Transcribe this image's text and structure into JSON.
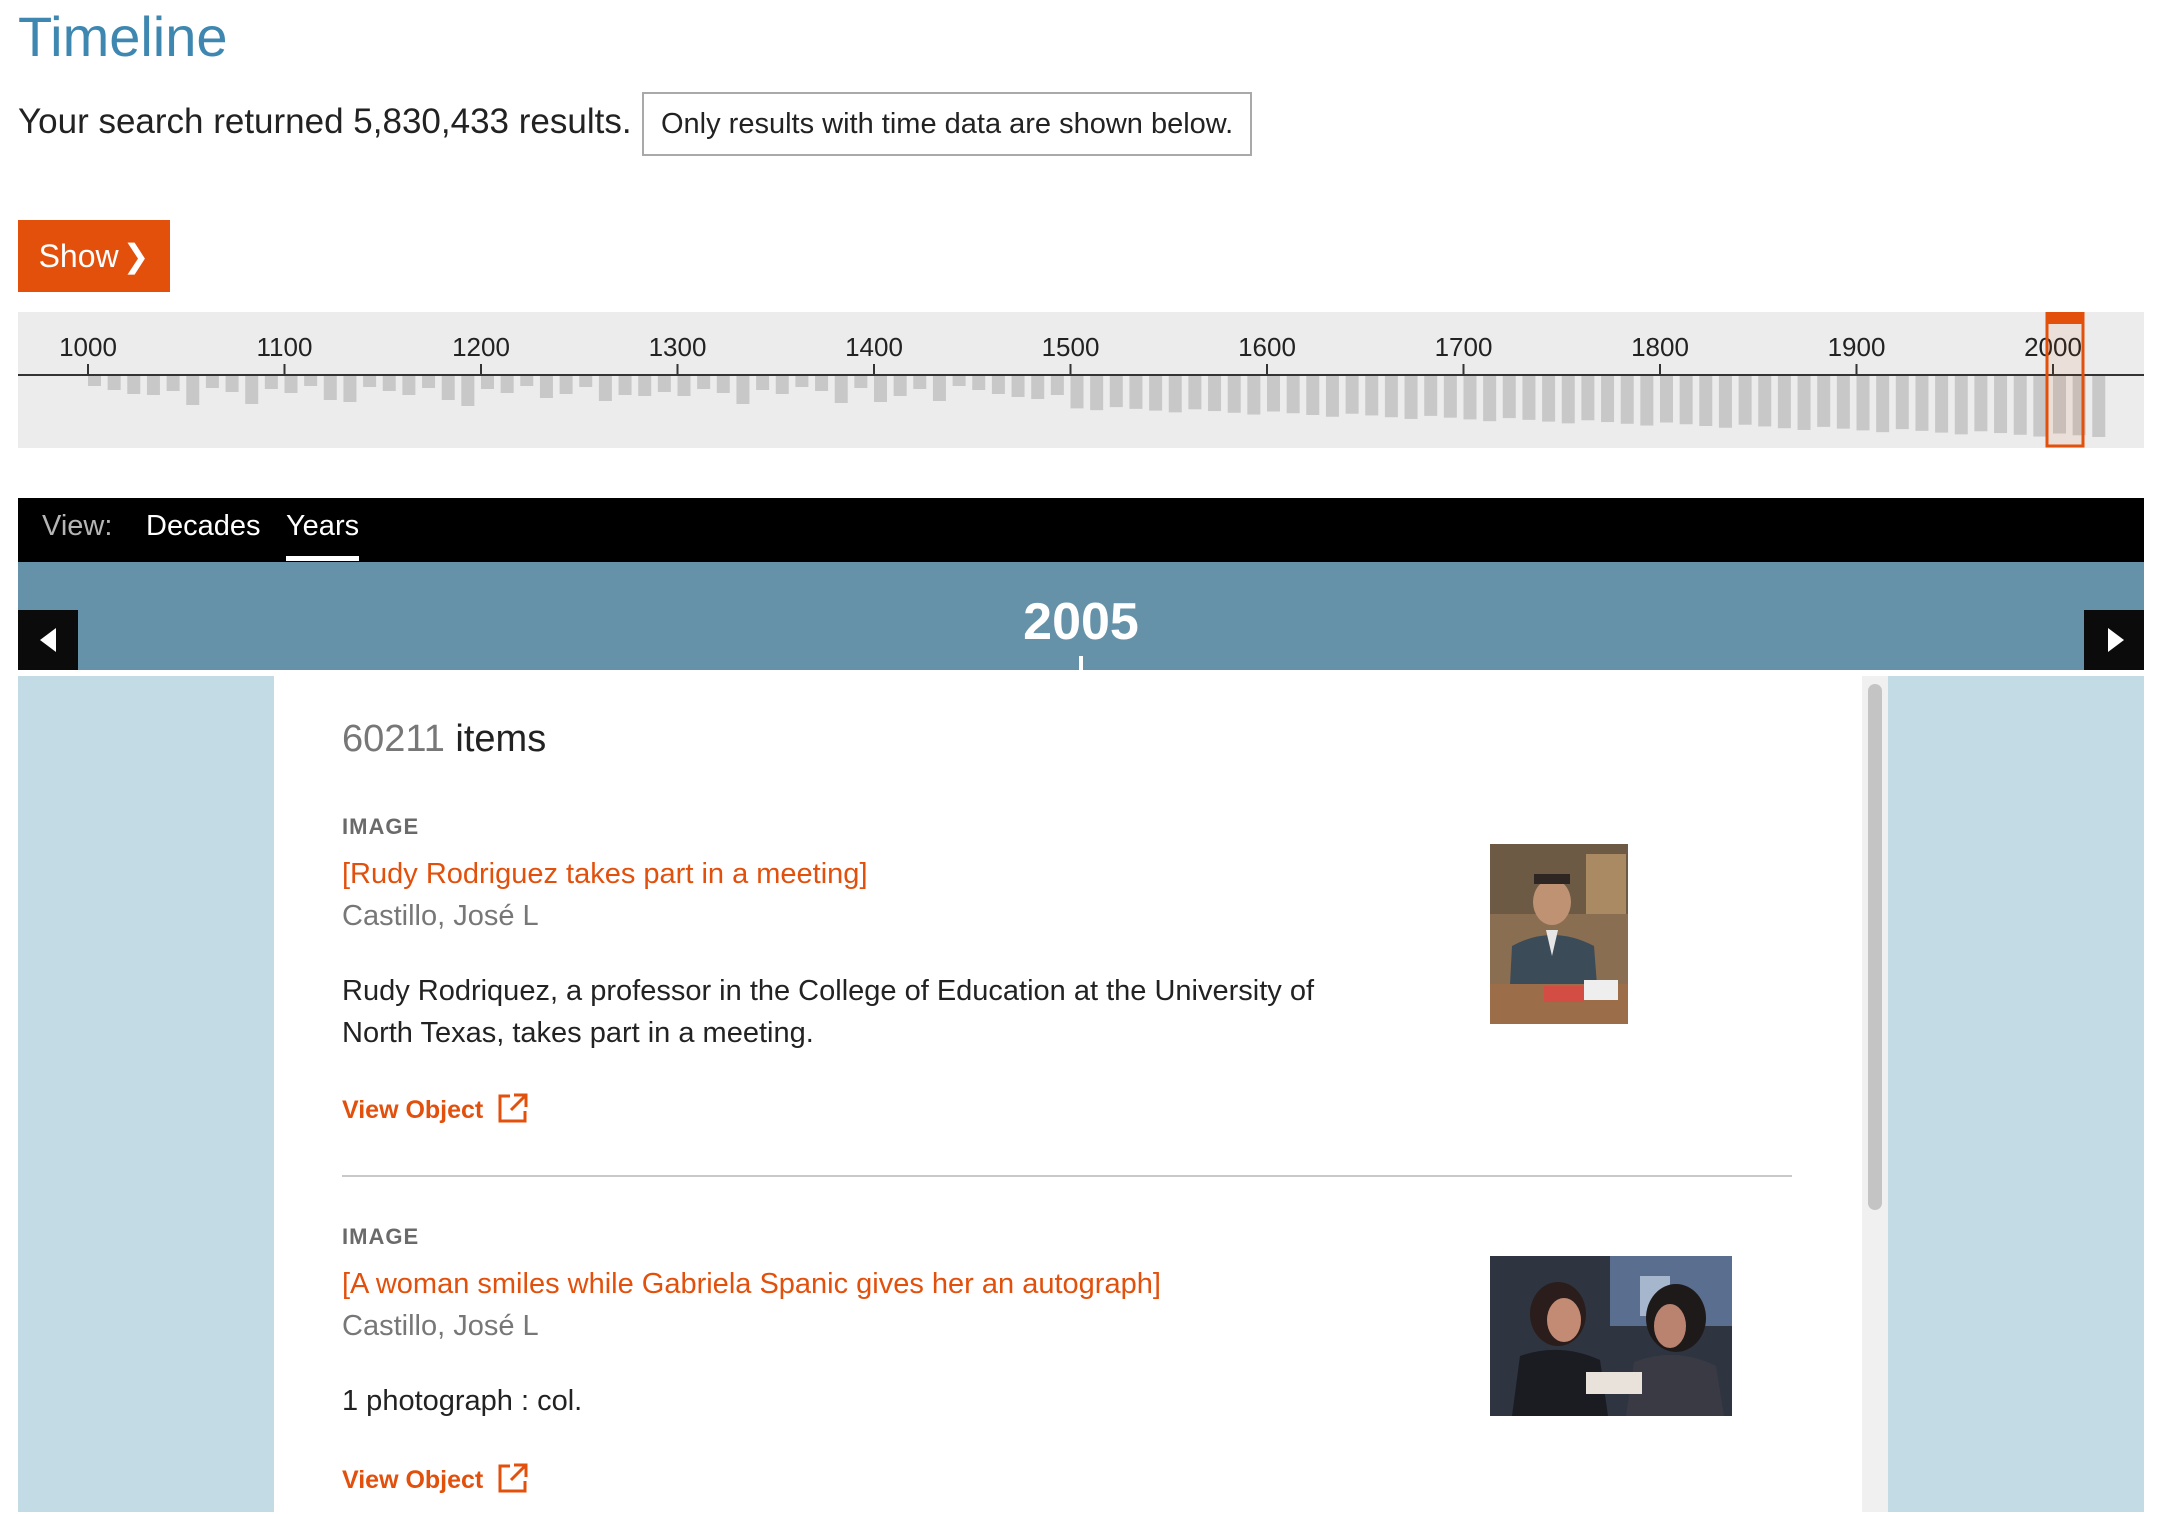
{
  "page": {
    "title": "Timeline",
    "summary": "Your search returned 5,830,433 results.",
    "notice": "Only results with time data are shown below."
  },
  "controls": {
    "show_label": "Show",
    "show_icon": "chevron-right-icon"
  },
  "histogram": {
    "tick_labels": [
      "1000",
      "1100",
      "1200",
      "1300",
      "1400",
      "1500",
      "1600",
      "1700",
      "1800",
      "1900",
      "2000"
    ],
    "selected_decade": "2000s"
  },
  "view": {
    "label": "View:",
    "tabs": [
      "Decades",
      "Years"
    ],
    "active_tab": "Years"
  },
  "year": {
    "current": "2005",
    "prev_icon": "arrow-left-icon",
    "next_icon": "arrow-right-icon"
  },
  "results": {
    "count_number": "60211",
    "count_suffix": " items",
    "items": [
      {
        "type": "IMAGE",
        "title": "[Rudy Rodriguez takes part in a meeting]",
        "creator": "Castillo, José L",
        "description": "Rudy Rodriquez, a professor in the College of Education at the University of North Texas, takes part in a meeting.",
        "link_label": "View Object",
        "link_icon": "external-link-icon"
      },
      {
        "type": "IMAGE",
        "title": "[A woman smiles while Gabriela Spanic gives her an autograph]",
        "creator": "Castillo, José L",
        "description": "1 photograph : col.",
        "link_label": "View Object",
        "link_icon": "external-link-icon"
      }
    ]
  },
  "colors": {
    "accent": "#e2500c",
    "title": "#3d87b1",
    "year_band": "#6592a8",
    "side_panel": "#c2dbe5",
    "histogram_bg": "#ececec",
    "histogram_bar": "#c8c8c8"
  }
}
